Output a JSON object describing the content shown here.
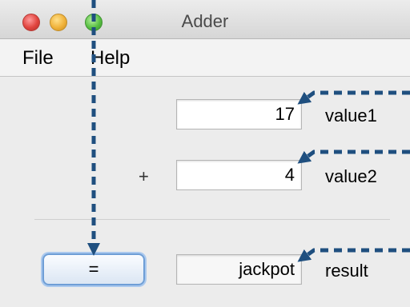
{
  "window": {
    "title": "Adder"
  },
  "menu": {
    "items": [
      "File",
      "Help"
    ]
  },
  "form": {
    "operator": "+",
    "value1": {
      "value": "17",
      "label": "value1"
    },
    "value2": {
      "value": "4",
      "label": "value2"
    },
    "result": {
      "value": "jackpot",
      "label": "result"
    },
    "equals_button_label": "="
  },
  "icons": {
    "close": "close-button-icon",
    "minimize": "minimize-button-icon",
    "zoom": "zoom-button-icon"
  },
  "colors": {
    "annotation_arrow": "#1f4f7f",
    "button_focus": "#6e9ed6"
  }
}
